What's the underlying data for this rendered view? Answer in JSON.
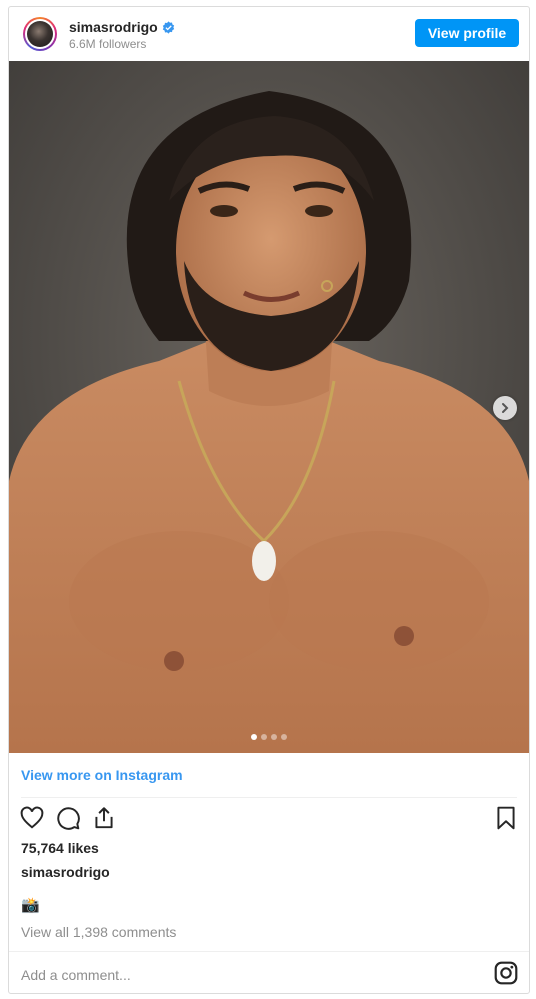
{
  "header": {
    "username": "simasrodrigo",
    "followers": "6.6M followers",
    "view_profile_label": "View profile",
    "verified_icon": "verified-badge-icon"
  },
  "post": {
    "carousel": {
      "total_slides": 4,
      "active_slide": 1
    },
    "view_more_label": "View more on Instagram",
    "likes": "75,764 likes",
    "caption_user": "simasrodrigo",
    "caption_text": "📸",
    "view_comments": "View all 1,398 comments",
    "add_comment_placeholder": "Add a comment..."
  },
  "actions": {
    "icons": [
      "heart-icon",
      "comment-icon",
      "share-icon",
      "bookmark-icon",
      "instagram-logo-icon"
    ]
  },
  "colors": {
    "accent": "#0095f6",
    "link": "#3897f0",
    "muted": "#8e8e8e",
    "border": "#dbdbdb"
  }
}
